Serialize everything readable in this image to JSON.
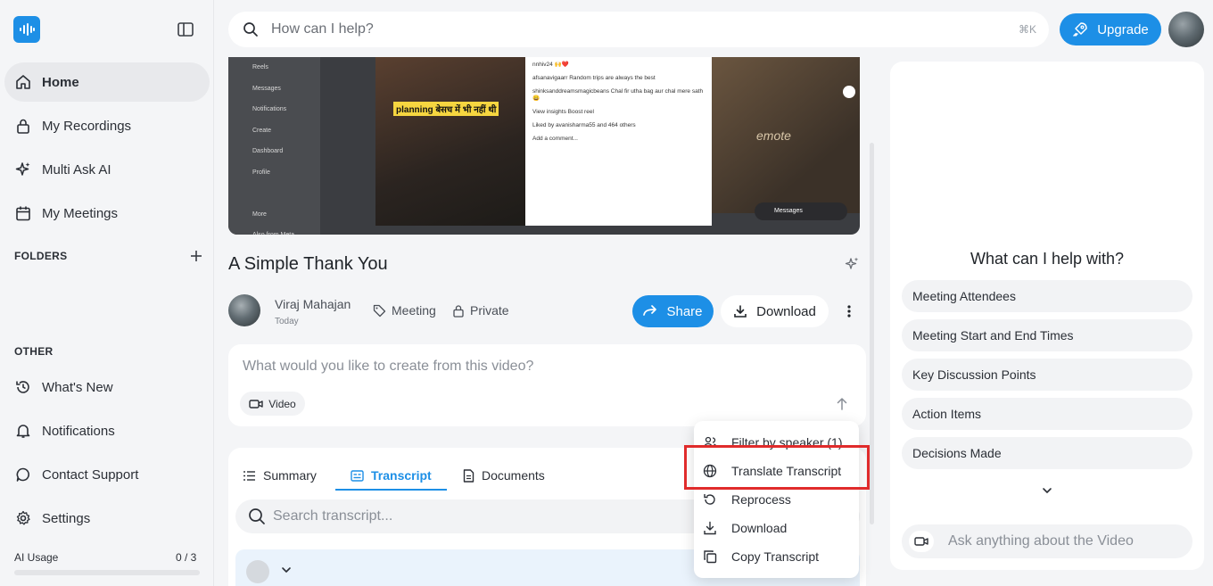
{
  "sidebar": {
    "nav": [
      {
        "label": "Home",
        "icon": "home-icon"
      },
      {
        "label": "My Recordings",
        "icon": "lock-icon"
      },
      {
        "label": "Multi Ask AI",
        "icon": "sparkle-icon"
      },
      {
        "label": "My Meetings",
        "icon": "calendar-icon"
      }
    ],
    "folders_label": "FOLDERS",
    "other_label": "OTHER",
    "other": [
      {
        "label": "What's New",
        "icon": "history-icon"
      },
      {
        "label": "Notifications",
        "icon": "bell-icon"
      },
      {
        "label": "Contact Support",
        "icon": "chat-icon"
      },
      {
        "label": "Settings",
        "icon": "gear-icon"
      }
    ],
    "usage_label": "AI Usage",
    "usage_count": "0 / 3",
    "usage_fraction": 0
  },
  "topbar": {
    "search_placeholder": "How can I help?",
    "shortcut": "⌘K",
    "upgrade_label": "Upgrade"
  },
  "thumbnail": {
    "ig_menu": [
      "Reels",
      "Messages",
      "Notifications",
      "Create",
      "Dashboard",
      "Profile",
      "",
      "More",
      "Also from Meta"
    ],
    "caption": "planning बेसच में भी नहीं थी",
    "comments": [
      "nnhiv24 🙌❤️",
      "afsanavigaarr Random trips are always the best",
      "shinksanddreamsmagicbeans Chal fir utha bag aur chal mere sath 😄",
      "View insights   Boost reel",
      "Liked by avanisharma55 and 464 others",
      "Add a comment..."
    ],
    "right_text": "emote",
    "messages": "Messages"
  },
  "recording": {
    "title": "A Simple Thank You",
    "owner": "Viraj Mahajan",
    "date": "Today",
    "tag": "Meeting",
    "privacy": "Private",
    "share_label": "Share",
    "download_label": "Download"
  },
  "create": {
    "placeholder": "What would you like to create from this video?",
    "chip_label": "Video"
  },
  "tabs": [
    {
      "label": "Summary"
    },
    {
      "label": "Transcript"
    },
    {
      "label": "Documents"
    }
  ],
  "transcript": {
    "search_placeholder": "Search transcript..."
  },
  "menu": {
    "items": [
      {
        "label": "Filter by speaker (1)",
        "icon": "speakers-icon"
      },
      {
        "label": "Translate Transcript",
        "icon": "globe-icon"
      },
      {
        "label": "Reprocess",
        "icon": "refresh-icon"
      },
      {
        "label": "Download",
        "icon": "download-icon"
      },
      {
        "label": "Copy Transcript",
        "icon": "copy-icon"
      }
    ]
  },
  "assistant": {
    "title": "What can I help with?",
    "suggestions": [
      "Meeting Attendees",
      "Meeting Start and End Times",
      "Key Discussion Points",
      "Action Items",
      "Decisions Made"
    ],
    "ask_placeholder": "Ask anything about the Video"
  },
  "colors": {
    "accent": "#1d8fe6",
    "highlight": "#e02b2b",
    "background": "#f4f5f7"
  }
}
